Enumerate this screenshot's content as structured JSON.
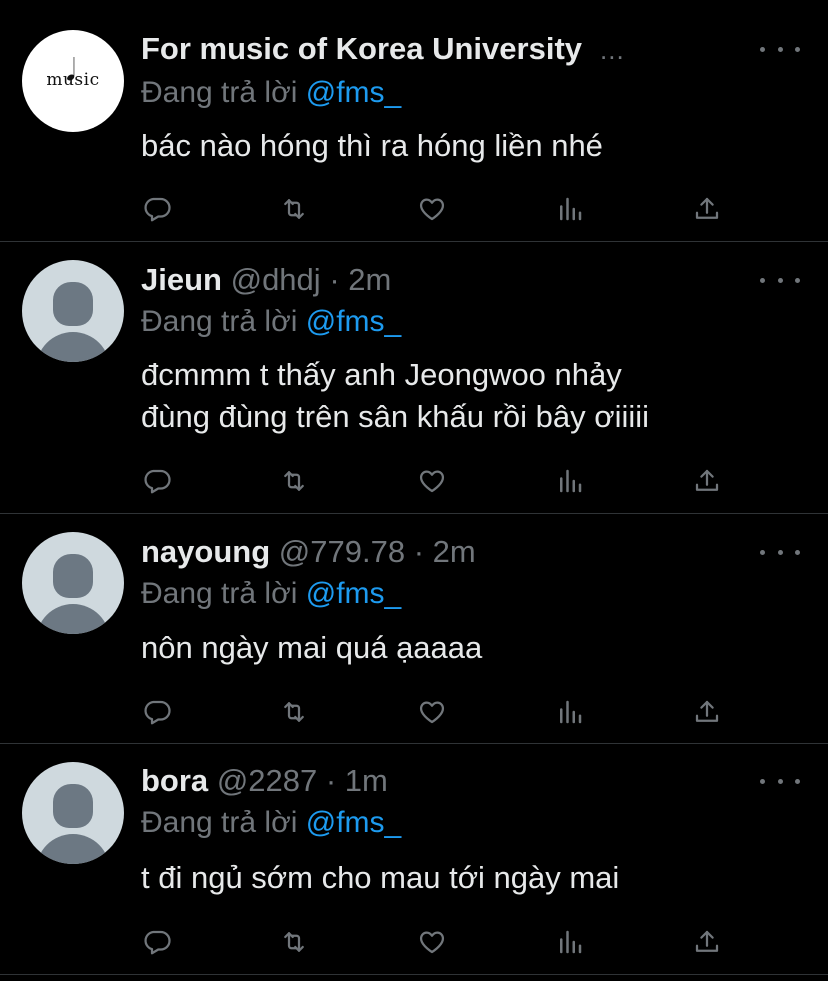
{
  "tweets": [
    {
      "display_name": "For music of Korea University",
      "handle": "",
      "time": "",
      "truncated": "...",
      "reply_prefix": "Đang trả lời",
      "reply_to": "@fms_",
      "lines": [
        "bác nào hóng thì ra hóng liền nhé"
      ],
      "avatar_text": "music"
    },
    {
      "display_name": "Jieun",
      "handle": "@dhdj",
      "time": "· 2m",
      "reply_prefix": "Đang trả lời",
      "reply_to": "@fms_",
      "lines": [
        "đcmmm t thấy anh Jeongwoo nhảy",
        "đùng đùng trên sân khấu rồi bây ơiiiii"
      ]
    },
    {
      "display_name": "nayoung",
      "handle": "@779.78",
      "time": "· 2m",
      "reply_prefix": "Đang trả lời",
      "reply_to": "@fms_",
      "lines": [
        "nôn ngày mai quá ạaaaa"
      ]
    },
    {
      "display_name": "bora",
      "handle": "@2287",
      "time": "· 1m",
      "reply_prefix": "Đang trả lời",
      "reply_to": "@fms_",
      "lines": [
        "t đi ngủ sớm cho mau tới ngày mai"
      ]
    }
  ],
  "icons": [
    "reply-icon",
    "retweet-icon",
    "like-icon",
    "analytics-icon",
    "share-icon",
    "more-icon"
  ],
  "colors": {
    "background": "#000000",
    "text": "#e7e9ea",
    "muted": "#71767b",
    "mention": "#1d9bf0",
    "divider": "#2f3336",
    "avatar_default": "#cfd9de"
  }
}
